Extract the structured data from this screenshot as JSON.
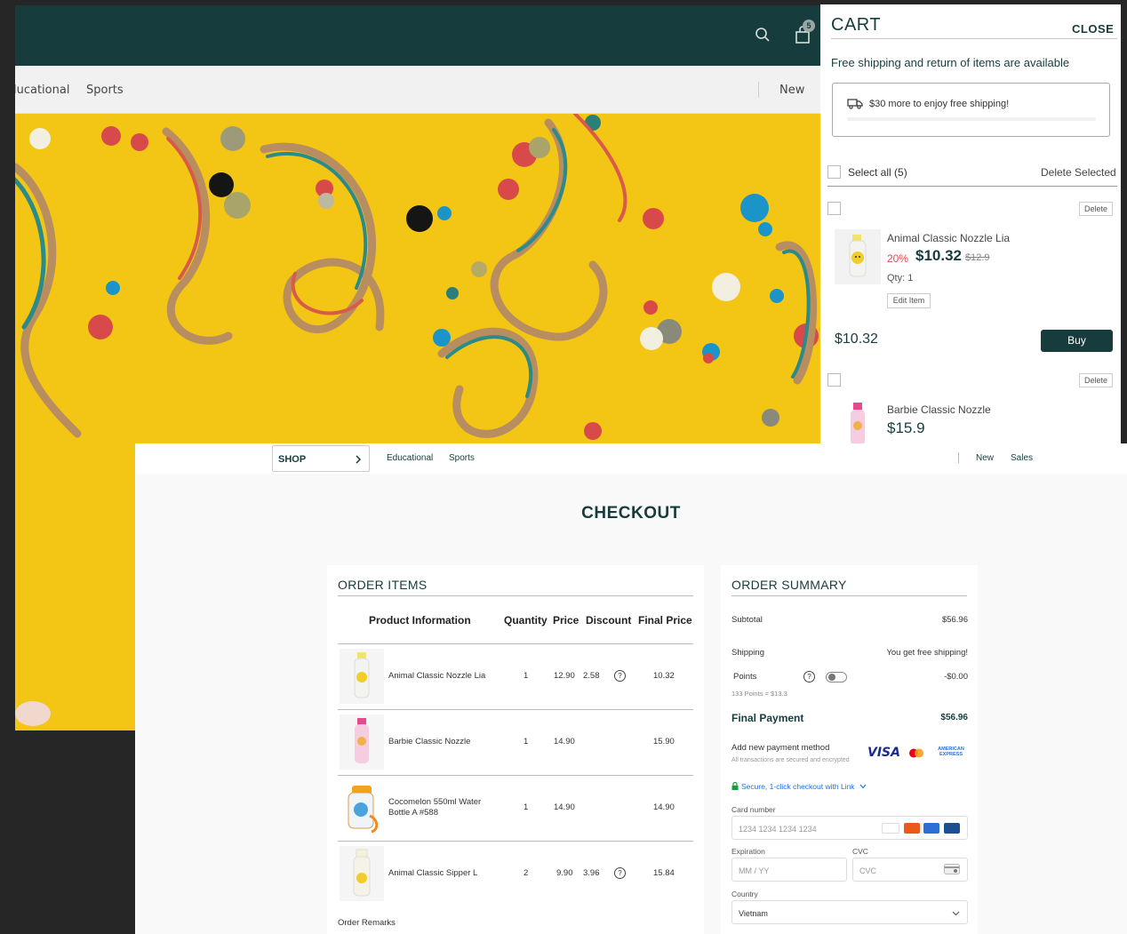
{
  "storefront": {
    "cart_badge_count": "5",
    "nav": {
      "left_items": [
        "lucational",
        "Sports"
      ],
      "right_items": [
        "New"
      ]
    }
  },
  "cart": {
    "title": "CART",
    "close_label": "CLOSE",
    "free_shipping_text": "Free shipping and return of items are available",
    "progress_text": "$30 more to enjoy free shipping!",
    "progress_fraction": 0.0,
    "select_all_label": "Select all (5)",
    "delete_selected_label": "Delete Selected",
    "delete_label": "Delete",
    "items": [
      {
        "name": "Animal Classic Nozzle Lia",
        "discount": "20%",
        "price": "$10.32",
        "old_price": "$12.9",
        "qty": "Qty: 1",
        "edit_label": "Edit Item",
        "total": "$10.32",
        "buy_label": "Buy"
      },
      {
        "name": "Barbie Classic Nozzle",
        "price": "$15.9"
      }
    ]
  },
  "checkout": {
    "nav": {
      "shop_label": "SHOP",
      "left_items": [
        "Educational",
        "Sports"
      ],
      "right_items": [
        "New",
        "Sales"
      ]
    },
    "title": "CHECKOUT",
    "order_items": {
      "title": "ORDER ITEMS",
      "headers": [
        "Product Information",
        "Quantity",
        "Price",
        "Discount",
        "Final Price"
      ],
      "rows": [
        {
          "name": "Animal Classic Nozzle Lia",
          "quantity": "1",
          "price": "12.90",
          "discount": "2.58",
          "final": "10.32",
          "has_help": true
        },
        {
          "name": "Barbie Classic Nozzle",
          "quantity": "1",
          "price": "14.90",
          "discount": "",
          "final": "15.90",
          "has_help": false
        },
        {
          "name": "Cocomelon 550ml Water Bottle A #588",
          "quantity": "1",
          "price": "14.90",
          "discount": "",
          "final": "14.90",
          "has_help": false
        },
        {
          "name": "Animal Classic Sipper L",
          "quantity": "2",
          "price": "9.90",
          "discount": "3.96",
          "final": "15.84",
          "has_help": true
        }
      ],
      "help_glyph": "?",
      "remarks_label": "Order Remarks"
    },
    "order_summary": {
      "title": "ORDER SUMMARY",
      "subtotal_label": "Subtotal",
      "subtotal_value": "$56.96",
      "shipping_label": "Shipping",
      "shipping_value": "You get free shipping!",
      "points_label": "Points",
      "points_value": "-$0.00",
      "points_note": "133 Points = $13.3",
      "points_enabled": false,
      "final_label": "Final Payment",
      "final_value": "$56.96",
      "add_payment_label": "Add new payment method",
      "secured_note": "All transactions are secured and encrypted",
      "visa_text": "VISA",
      "amex_text": "AMERICAN EXPRESS",
      "link_text": "Secure, 1-click checkout with Link",
      "card_number_label": "Card number",
      "card_number_placeholder": "1234 1234 1234 1234",
      "expiration_label": "Expiration",
      "expiration_placeholder": "MM / YY",
      "cvc_label": "CVC",
      "cvc_placeholder": "CVC",
      "country_label": "Country",
      "country_value": "Vietnam"
    }
  },
  "colors": {
    "brand_dark": "#173c3e",
    "discount_red": "#e54b4b",
    "banner_yellow": "#f3c515",
    "link_blue": "#1a73e8",
    "whatsapp_green": "#25c04f"
  },
  "icons": [
    "search-icon",
    "shopping-bag-icon",
    "truck-icon",
    "chevron-right-icon",
    "help-icon",
    "lock-icon",
    "chevron-down-icon",
    "whatsapp-icon",
    "cvc-card-icon"
  ]
}
